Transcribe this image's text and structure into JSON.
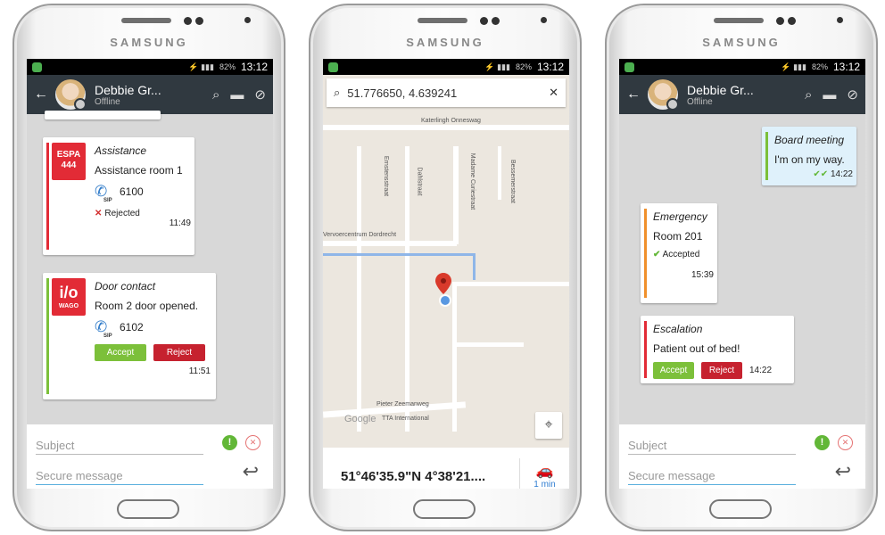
{
  "device": {
    "brand": "SAMSUNG"
  },
  "status": {
    "time": "13:12",
    "battery": "82%"
  },
  "contact": {
    "name": "Debbie Gr...",
    "status": "Offline"
  },
  "phone1": {
    "messages": [
      {
        "title": "Assistance",
        "badge_top": "ESPA",
        "badge_bottom": "444",
        "text": "Assistance room 1",
        "sip": "6100",
        "state": "Rejected",
        "time": "11:49",
        "color": "#e22b36"
      },
      {
        "title": "Door contact",
        "badge_top": "i/o",
        "badge_bottom": "WAGO",
        "text": "Room 2 door opened.",
        "sip": "6102",
        "accept": "Accept",
        "reject": "Reject",
        "time": "11:51",
        "color": "#7cc03a"
      }
    ]
  },
  "composer": {
    "subject_placeholder": "Subject",
    "message_placeholder": "Secure message",
    "warn_symbol": "!"
  },
  "map": {
    "search_query": "51.776650, 4.639241",
    "clear": "✕",
    "streets": [
      "Katerlingh Onneswag",
      "Ernstensstraat",
      "Dahlstraat",
      "Madame Curiestraat",
      "Bessemerstraat",
      "Pieter Zeemanweg",
      "TTA International",
      "Vervoercentrum Dordrecht"
    ],
    "logo": "Google",
    "coord_text": "51°46'35.9\"N 4°38'21....",
    "eta": "1 min"
  },
  "phone3": {
    "messages": [
      {
        "title": "Board meeting",
        "text": "I'm on my way.",
        "time": "14:22",
        "color": "#7cc03a"
      },
      {
        "title": "Emergency",
        "text": "Room 201",
        "state": "Accepted",
        "time": "15:39",
        "color": "#f0902b"
      },
      {
        "title": "Escalation",
        "text": "Patient out of bed!",
        "accept": "Accept",
        "reject": "Reject",
        "time": "14:22",
        "color": "#e22b36"
      }
    ]
  }
}
